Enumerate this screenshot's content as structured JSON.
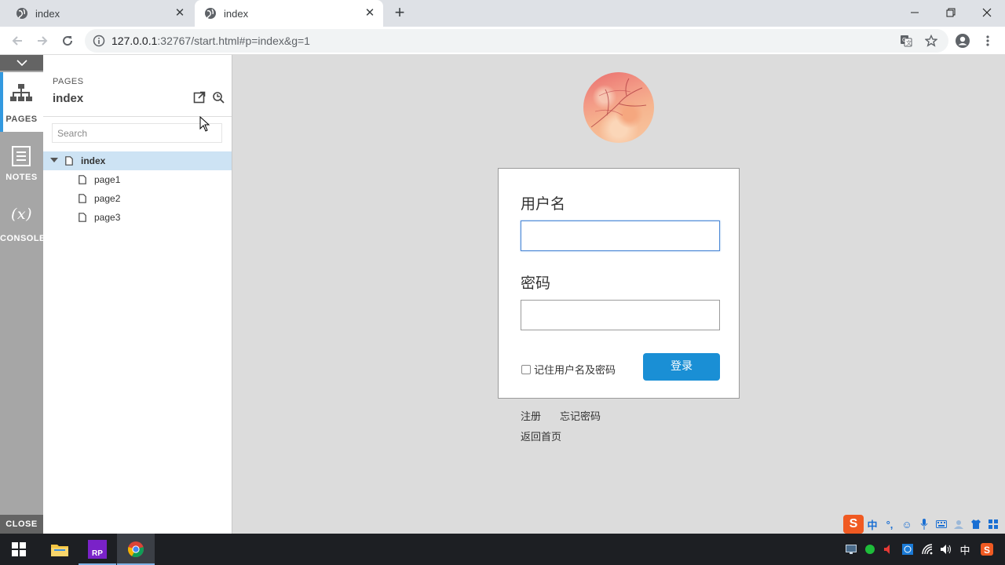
{
  "browser": {
    "tabs": [
      {
        "title": "index",
        "active": false
      },
      {
        "title": "index",
        "active": true
      }
    ],
    "new_tab": "+",
    "url_host": "127.0.0.1",
    "url_rest": ":32767/start.html#p=index&g=1"
  },
  "rail": {
    "pages_label": "PAGES",
    "notes_label": "NOTES",
    "console_label": "CONSOLE",
    "console_glyph": "(x)",
    "close_label": "CLOSE"
  },
  "pages_panel": {
    "kicker": "PAGES",
    "title": "index",
    "search_placeholder": "Search",
    "tree": [
      {
        "label": "index",
        "selected": true,
        "level": 0
      },
      {
        "label": "page1",
        "selected": false,
        "level": 1
      },
      {
        "label": "page2",
        "selected": false,
        "level": 1
      },
      {
        "label": "page3",
        "selected": false,
        "level": 1
      }
    ]
  },
  "login": {
    "username_label": "用户名",
    "password_label": "密码",
    "remember_label": "记住用户名及密码",
    "login_button": "登录",
    "register_link": "注册",
    "forgot_link": "忘记密码",
    "home_link": "返回首页"
  },
  "ime": {
    "logo": "S",
    "mode": "中"
  },
  "taskbar": {
    "tray_lang": "中"
  },
  "colors": {
    "accent": "#1a8fd5",
    "rail": "#a6a6a6",
    "rail_dark": "#646464",
    "selection": "#cde3f4",
    "canvas": "#dcdcdc"
  }
}
